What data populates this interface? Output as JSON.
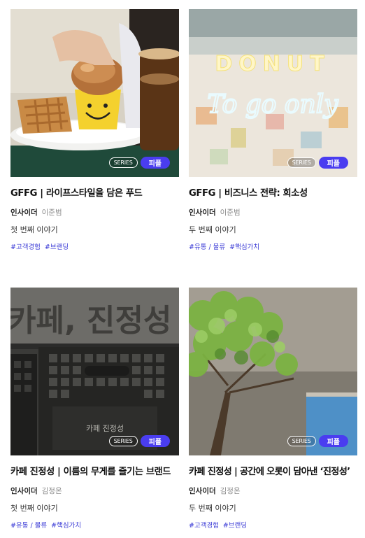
{
  "colors": {
    "accent": "#4a3df0",
    "tag": "#3b3bd6",
    "author": "#8a8a8a"
  },
  "cards": [
    {
      "title": "GFFG | 라이프스타일을 담은 푸드",
      "category": "인사이더",
      "author": "이준범",
      "episode": "첫 번째 이야기",
      "tags": [
        "#고객경험",
        "#브랜딩"
      ],
      "badge_series": "SERIES",
      "badge_pick": "피플",
      "image": "donut-in-smiley-cup-photo"
    },
    {
      "title": "GFFG | 비즈니스 전략: 희소성",
      "category": "인사이더",
      "author": "이준범",
      "episode": "두 번째 이야기",
      "tags": [
        "#유통 / 물류",
        "#핵심가치"
      ],
      "badge_series": "SERIES",
      "badge_pick": "피플",
      "image": "donut-to-go-only-neon-sign-photo",
      "neon_top": "DONUT",
      "neon_script": "To go only"
    },
    {
      "title": "카페 진정성 | 이름의 무게를 즐기는 브랜드",
      "category": "인사이더",
      "author": "김정온",
      "episode": "첫 번째 이야기",
      "tags": [
        "#유통 / 물류",
        "#핵심가치"
      ],
      "badge_series": "SERIES",
      "badge_pick": "피플",
      "image": "black-crates-photo",
      "sign_text": "카페, 진정성",
      "crate_text": "카페 진정성"
    },
    {
      "title": "카페 진정성 | 공간에 오롯이 담아낸 ‘진정성’",
      "category": "인사이더",
      "author": "김정온",
      "episode": "두 번째 이야기",
      "tags": [
        "#고객경험",
        "#브랜딩"
      ],
      "badge_series": "SERIES",
      "badge_pick": "피플",
      "image": "tree-and-concrete-wall-photo"
    }
  ]
}
